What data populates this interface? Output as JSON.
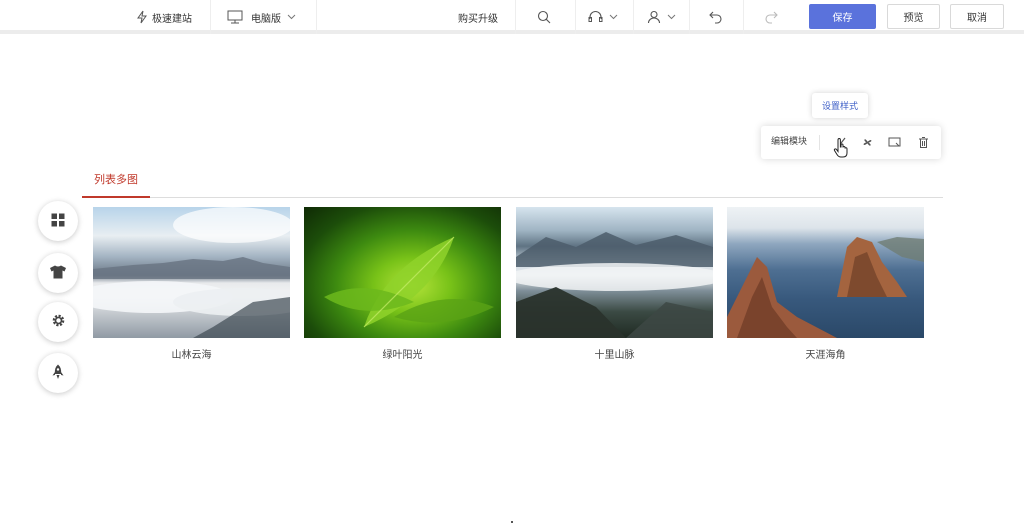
{
  "toolbar": {
    "quick_build": "极速建站",
    "device": "电脑版",
    "upgrade": "购买升级",
    "save": "保存",
    "preview": "预览",
    "cancel": "取消"
  },
  "module_toolbar": {
    "tooltip": "设置样式",
    "edit_label": "编辑模块"
  },
  "tabs": [
    {
      "label": "列表多图",
      "active": true
    }
  ],
  "gallery": [
    {
      "caption": "山林云海"
    },
    {
      "caption": "绿叶阳光"
    },
    {
      "caption": "十里山脉"
    },
    {
      "caption": "天涯海角"
    }
  ],
  "side_buttons": [
    "grid-icon",
    "shirt-icon",
    "gear-icon",
    "rocket-icon"
  ],
  "colors": {
    "accent": "#5a72dc",
    "tab_active": "#c0392b",
    "tooltip_text": "#3e5fc7"
  }
}
